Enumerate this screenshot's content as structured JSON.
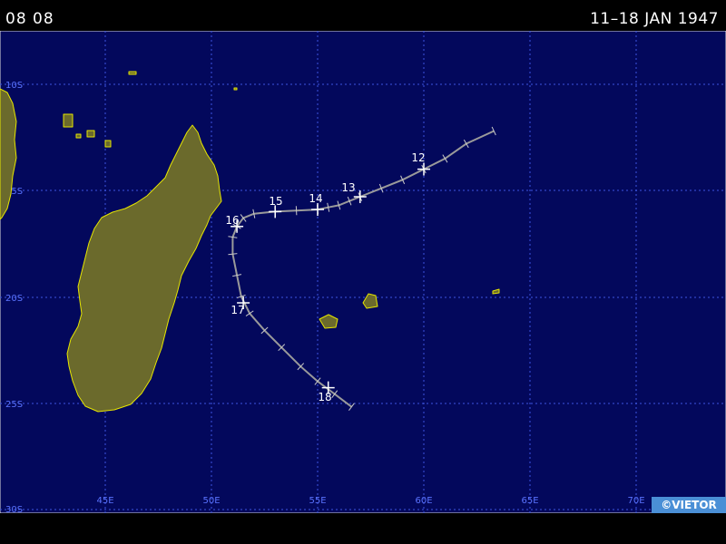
{
  "header": {
    "storm_id": "08 08",
    "date_range": "11–18 JAN 1947"
  },
  "credit": "©VIETOR",
  "colors": {
    "ocean": "#03085c",
    "land": "#6b6a2c",
    "coast": "#e6e600",
    "grid": "#3d55e0",
    "track": "#9a9a9a"
  },
  "latitude_labels": [
    "10S",
    "15S",
    "20S",
    "25S",
    "30S"
  ],
  "longitude_labels": [
    "45E",
    "50E",
    "55E",
    "60E",
    "65E",
    "70E"
  ],
  "day_labels": [
    "12",
    "13",
    "14",
    "15",
    "16",
    "17",
    "18"
  ],
  "track": [
    [
      63.3,
      -12.2
    ],
    [
      62.0,
      -12.8
    ],
    [
      61.0,
      -13.5
    ],
    [
      60.0,
      -14.0
    ],
    [
      59.0,
      -14.5
    ],
    [
      58.0,
      -14.9
    ],
    [
      57.0,
      -15.3
    ],
    [
      56.5,
      -15.5
    ],
    [
      56.0,
      -15.7
    ],
    [
      55.5,
      -15.8
    ],
    [
      55.0,
      -15.9
    ],
    [
      54.0,
      -15.95
    ],
    [
      53.0,
      -16.0
    ],
    [
      52.0,
      -16.1
    ],
    [
      51.5,
      -16.3
    ],
    [
      51.2,
      -16.7
    ],
    [
      51.0,
      -17.2
    ],
    [
      51.0,
      -18.0
    ],
    [
      51.2,
      -19.0
    ],
    [
      51.4,
      -20.0
    ],
    [
      51.8,
      -20.8
    ],
    [
      52.5,
      -21.6
    ],
    [
      53.3,
      -22.4
    ],
    [
      54.2,
      -23.3
    ],
    [
      55.0,
      -24.0
    ],
    [
      55.8,
      -24.6
    ],
    [
      56.6,
      -25.2
    ]
  ],
  "day_positions": [
    [
      60.0,
      -14.0
    ],
    [
      57.0,
      -15.3
    ],
    [
      55.0,
      -15.9
    ],
    [
      53.0,
      -16.0
    ],
    [
      51.2,
      -16.7
    ],
    [
      51.5,
      -20.3
    ],
    [
      55.5,
      -24.3
    ]
  ]
}
